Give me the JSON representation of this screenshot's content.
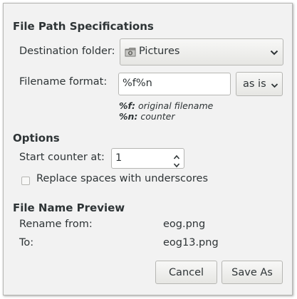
{
  "file_path": {
    "title": "File Path Specifications",
    "destination_label": "Destination folder:",
    "destination_value": "Pictures",
    "destination_icon": "camera-folder-icon",
    "filename_label": "Filename format:",
    "filename_value": "%f%n",
    "case_value": "as is",
    "hint1_code": "%f:",
    "hint1_text": " original filename",
    "hint2_code": "%n:",
    "hint2_text": " counter"
  },
  "options": {
    "title": "Options",
    "counter_label": "Start counter at:",
    "counter_value": "1",
    "replace_spaces_label": "Replace spaces with underscores",
    "replace_spaces_checked": false
  },
  "preview": {
    "title": "File Name Preview",
    "rename_from_label": "Rename from:",
    "rename_from_value": "eog.png",
    "to_label": "To:",
    "to_value": "eog13.png"
  },
  "buttons": {
    "cancel": "Cancel",
    "save_as": "Save As"
  }
}
